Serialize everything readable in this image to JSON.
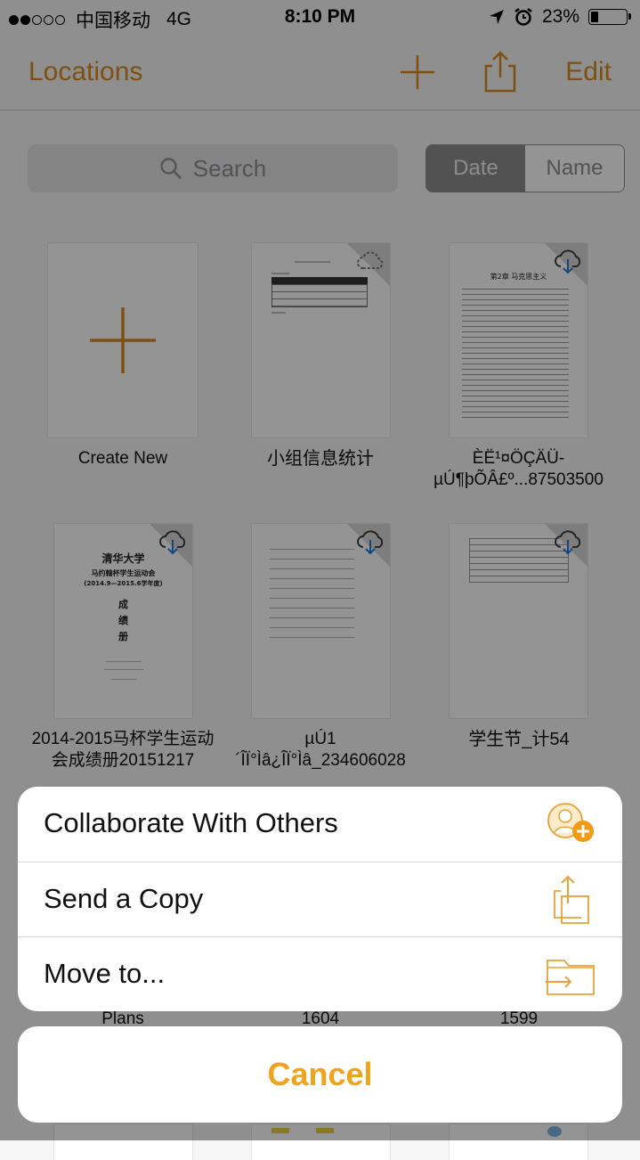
{
  "status_bar": {
    "carrier": "中国移动",
    "network": "4G",
    "time": "8:10 PM",
    "battery": "23%",
    "battery_level": 0.23
  },
  "nav": {
    "back_label": "Locations",
    "edit_label": "Edit"
  },
  "search": {
    "placeholder": "Search"
  },
  "sort": {
    "options": [
      "Date",
      "Name"
    ],
    "selected": "Date"
  },
  "documents": [
    {
      "label": "Create New",
      "type": "new"
    },
    {
      "label": "小组信息统计",
      "type": "table-doc",
      "cloud": "dashed"
    },
    {
      "label": "ÈË¹¤ÖÇÄÜ-\nµÚ¶þÕÂ£º...87503500",
      "type": "text-doc",
      "cloud": "download"
    },
    {
      "label": "2014-2015马杯学生运动\n会成绩册20151217",
      "type": "cover-doc",
      "cloud": "download",
      "cover": {
        "university": "清华大学",
        "event": "马约翰杯学生运动会",
        "year": "(2014.9—2015.6学年度)",
        "c1": "成",
        "c2": "绩",
        "c3": "册"
      }
    },
    {
      "label": "µÚ1\n´ÎÏ°Ìâ¿ÎÏ°Ìâ_234606028",
      "type": "sketch-doc",
      "cloud": "download"
    },
    {
      "label": "学生节_计54",
      "type": "form-doc",
      "cloud": "download"
    }
  ],
  "hidden_row_labels": [
    "Plans",
    "1604",
    "1599"
  ],
  "action_sheet": {
    "items": [
      {
        "label": "Collaborate With Others",
        "icon": "collaborate-icon"
      },
      {
        "label": "Send a Copy",
        "icon": "send-copy-icon"
      },
      {
        "label": "Move to...",
        "icon": "move-folder-icon"
      }
    ],
    "cancel_label": "Cancel"
  },
  "colors": {
    "accent": "#d98a1e",
    "cancel": "#f0a31c",
    "cloud_download": "#1e7bd6"
  }
}
